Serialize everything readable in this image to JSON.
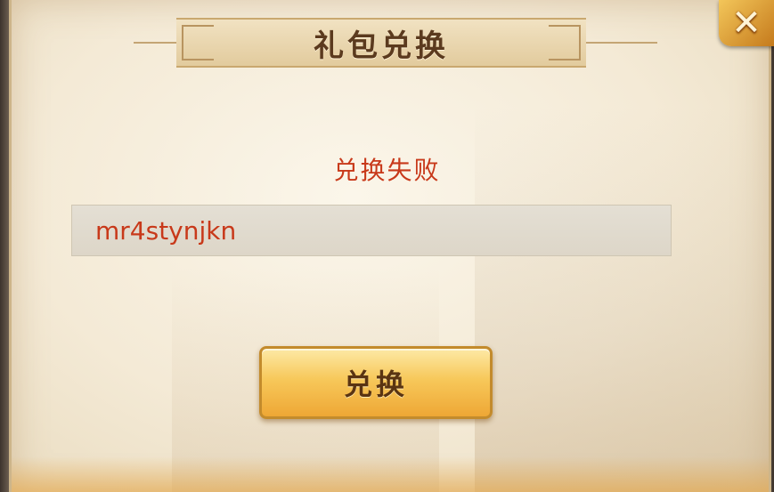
{
  "dialog": {
    "title": "礼包兑换",
    "status": "兑换失败",
    "code_value": "mr4stynjkn",
    "redeem_label": "兑换",
    "close_icon": "close-x-icon"
  },
  "colors": {
    "status_red": "#c8391a",
    "title_brown": "#5b3a1e",
    "button_gold": "#f7c85a"
  }
}
